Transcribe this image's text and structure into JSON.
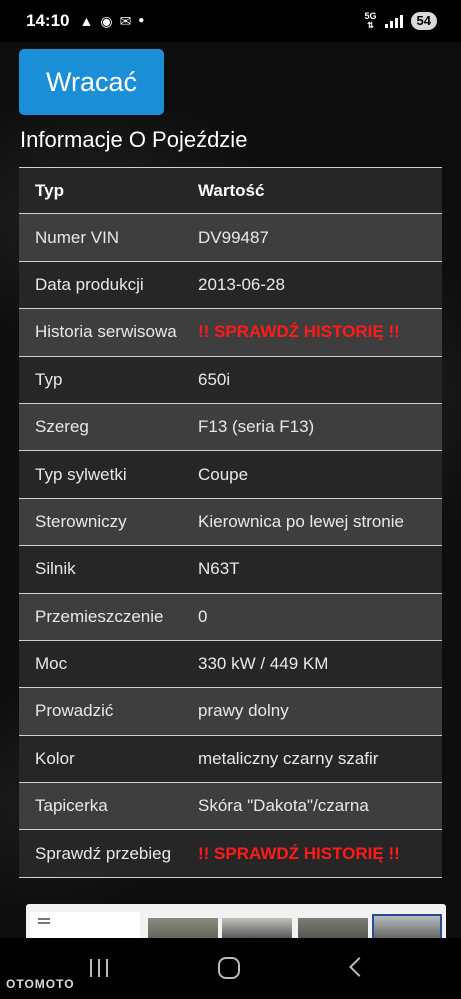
{
  "status_bar": {
    "time": "14:10",
    "notification_icons": [
      "warning-icon",
      "messenger-icon",
      "mail-icon",
      "dot-icon"
    ],
    "network": "5G",
    "battery": "54"
  },
  "back_button": {
    "label": "Wracać"
  },
  "section_title": "Informacje O Pojeździe",
  "table": {
    "header": {
      "label": "Typ",
      "value": "Wartość"
    },
    "rows": [
      {
        "label": "Numer VIN",
        "value": "DV99487",
        "alert": false
      },
      {
        "label": "Data produkcji",
        "value": "2013-06-28",
        "alert": false
      },
      {
        "label": "Historia serwisowa",
        "value": "!! SPRAWDŹ HISTORIĘ !!",
        "alert": true
      },
      {
        "label": "Typ",
        "value": "650i",
        "alert": false
      },
      {
        "label": "Szereg",
        "value": "F13 (seria F13)",
        "alert": false
      },
      {
        "label": "Typ sylwetki",
        "value": "Coupe",
        "alert": false
      },
      {
        "label": "Sterowniczy",
        "value": "Kierownica po lewej stronie",
        "alert": false
      },
      {
        "label": "Silnik",
        "value": "N63T",
        "alert": false
      },
      {
        "label": "Przemieszczenie",
        "value": "0",
        "alert": false
      },
      {
        "label": "Moc",
        "value": "330 kW / 449 KM",
        "alert": false
      },
      {
        "label": "Prowadzić",
        "value": "prawy dolny",
        "alert": false
      },
      {
        "label": "Kolor",
        "value": "metaliczny czarny szafir",
        "alert": false
      },
      {
        "label": "Tapicerka",
        "value": "Skóra \"Dakota\"/czarna",
        "alert": false
      },
      {
        "label": "Sprawdź przebieg",
        "value": "!! SPRAWDŹ HISTORIĘ !!",
        "alert": true
      }
    ]
  },
  "colors": {
    "accent": "#1a8fd8",
    "alert": "#ff1a1a",
    "row_dark": "#262626",
    "row_light": "#3e3e3e"
  },
  "watermark": "OTOMOTO"
}
